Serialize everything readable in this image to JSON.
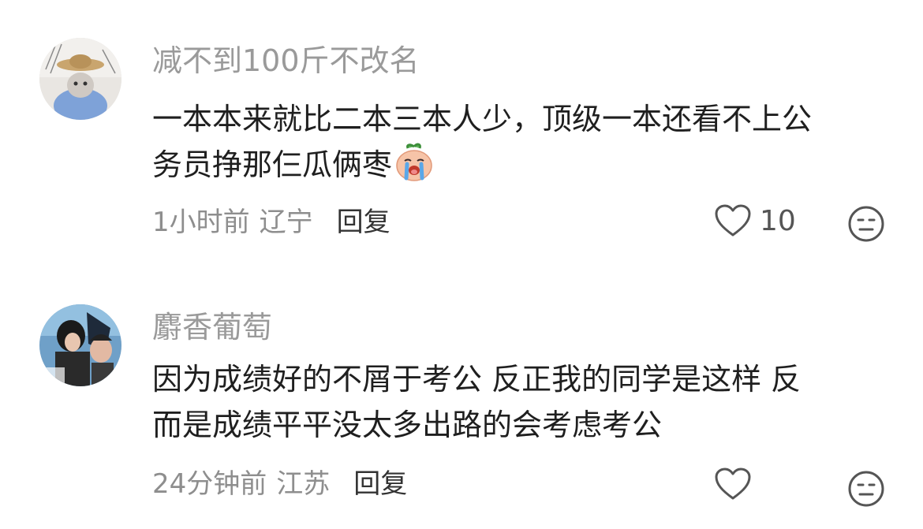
{
  "comments": [
    {
      "username": "减不到100斤不改名",
      "content_lines": [
        "一本本来就比二本三本人少，顶级一本还看不上公",
        "务员挣那仨瓜俩枣"
      ],
      "emoji_icon": "crying-peach-emoji",
      "time": "1小时前",
      "location": "辽宁",
      "reply_label": "回复",
      "like_count": "10"
    },
    {
      "username": "麝香葡萄",
      "content_lines": [
        "因为成绩好的不屑于考公 反正我的同学是这样 反",
        "而是成绩平平没太多出路的会考虑考公"
      ],
      "time": "24分钟前",
      "location": "江苏",
      "reply_label": "回复",
      "like_count": ""
    }
  ],
  "icons": {
    "like": "heart-outline-icon",
    "dislike": "neutral-face-icon"
  },
  "colors": {
    "username": "#9a9a9a",
    "meta": "#8e8e8e",
    "content": "#1f1f1f",
    "icon": "#555555"
  }
}
